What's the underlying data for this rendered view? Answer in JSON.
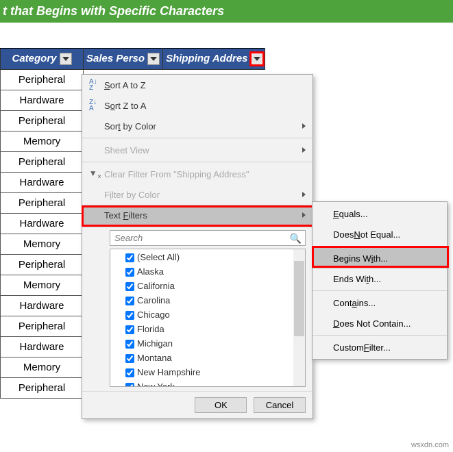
{
  "title": "t that Begins with Specific Characters",
  "headers": {
    "category": "Category",
    "sales": "Sales Perso",
    "shipping": "Shipping Addres"
  },
  "rows": [
    "Peripheral",
    "Hardware",
    "Peripheral",
    "Memory",
    "Peripheral",
    "Hardware",
    "Peripheral",
    "Hardware",
    "Memory",
    "Peripheral",
    "Memory",
    "Hardware",
    "Peripheral",
    "Hardware",
    "Memory",
    "Peripheral"
  ],
  "menu": {
    "sortAZ": "Sort A to Z",
    "sortZA": "Sort Z to A",
    "sortColor": "Sort by Color",
    "sheetView": "Sheet View",
    "clearFilter": "Clear Filter From \"Shipping Address\"",
    "filterColor": "Filter by Color",
    "textFilters": "Text Filters",
    "searchPlaceholder": "Search",
    "selectAll": "(Select All)",
    "items": [
      "Alaska",
      "California",
      "Carolina",
      "Chicago",
      "Florida",
      "Michigan",
      "Montana",
      "New Hampshire",
      "New York"
    ],
    "ok": "OK",
    "cancel": "Cancel"
  },
  "submenu": {
    "equals": "Equals...",
    "notEqual": "Does Not Equal...",
    "beginsWith": "Begins With...",
    "endsWith": "Ends With...",
    "contains": "Contains...",
    "notContain": "Does Not Contain...",
    "custom": "Custom Filter..."
  },
  "watermark": "wsxdn.com"
}
